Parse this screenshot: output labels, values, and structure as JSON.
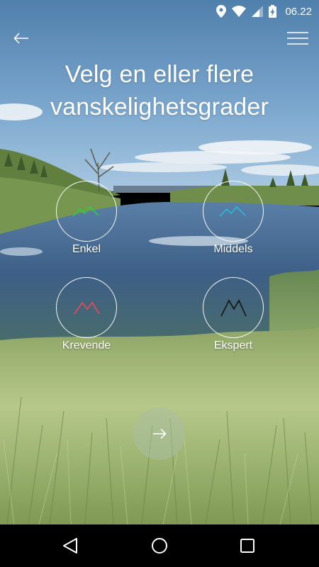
{
  "status_bar": {
    "time": "06.22",
    "icons": [
      "location-icon",
      "wifi-icon",
      "signal-icon",
      "battery-charging-icon"
    ]
  },
  "header": {
    "back_icon": "arrow-left-icon",
    "menu_icon": "hamburger-menu-icon",
    "title_line1": "Velg en eller flere",
    "title_line2": "vanskelighetsgrader"
  },
  "difficulties": [
    {
      "label": "Enkel",
      "color": "#2ecc40",
      "icon": "mountain-icon"
    },
    {
      "label": "Middels",
      "color": "#29b6d8",
      "icon": "mountain-icon"
    },
    {
      "label": "Krevende",
      "color": "#e04a5a",
      "icon": "mountain-icon"
    },
    {
      "label": "Ekspert",
      "color": "#1a1a1a",
      "icon": "mountain-icon"
    }
  ],
  "next_button": {
    "icon": "arrow-right-icon"
  },
  "nav_bar": {
    "icons": [
      "nav-back-icon",
      "nav-home-icon",
      "nav-recents-icon"
    ]
  }
}
